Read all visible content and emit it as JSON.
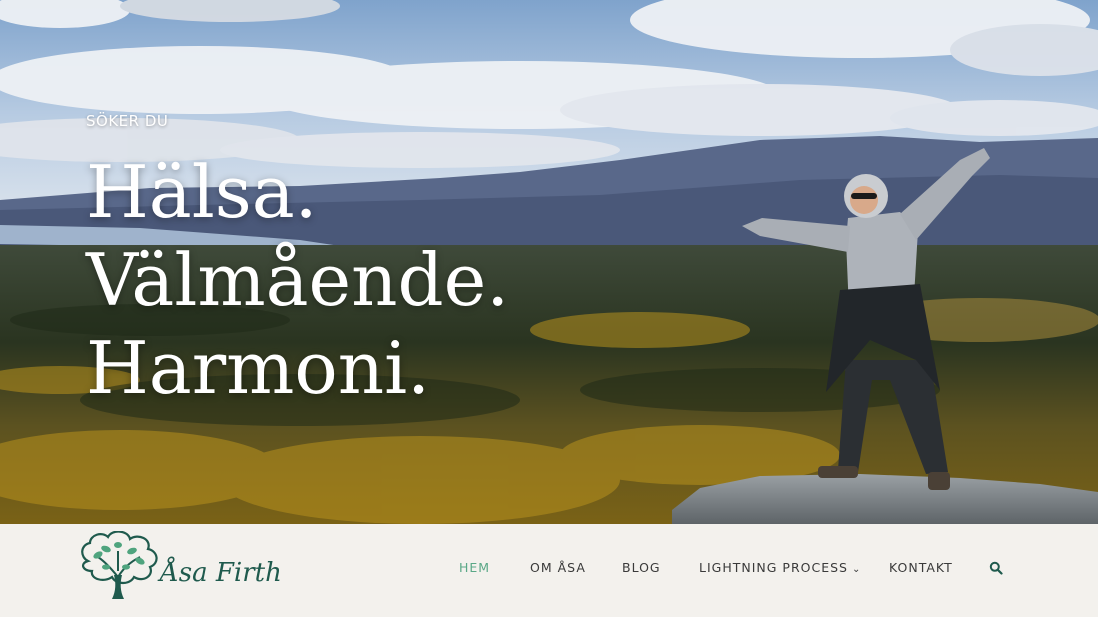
{
  "hero": {
    "kicker": "SÖKER DU",
    "lines": [
      "Hälsa.",
      "Välmående.",
      "Harmoni."
    ]
  },
  "logo": {
    "text": "Åsa Firth",
    "icon": "tree-icon"
  },
  "nav": {
    "items": [
      {
        "label": "HEM",
        "active": true
      },
      {
        "label": "OM ÅSA",
        "active": false
      },
      {
        "label": "BLOG",
        "active": false
      },
      {
        "label": "LIGHTNING PROCESS",
        "active": false,
        "has_dropdown": true
      },
      {
        "label": "KONTAKT",
        "active": false
      }
    ],
    "search_icon": "search-icon"
  },
  "colors": {
    "accent": "#5aa887",
    "logo": "#1f5a4d",
    "nav_bg": "#f3f1ed",
    "nav_text": "#3a3a3a"
  }
}
